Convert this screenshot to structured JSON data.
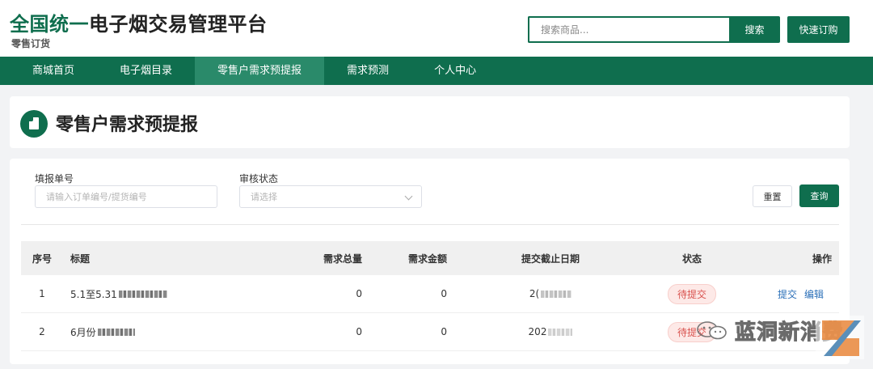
{
  "header": {
    "title_accent": "全国统一",
    "title_rest": "电子烟交易管理平台",
    "subtitle": "零售订货",
    "search_placeholder": "搜索商品...",
    "search_button": "搜索",
    "quick_order_button": "快速订购"
  },
  "nav": {
    "items": [
      {
        "label": "商城首页",
        "active": false
      },
      {
        "label": "电子烟目录",
        "active": false
      },
      {
        "label": "零售户需求预提报",
        "active": true
      },
      {
        "label": "需求预测",
        "active": false
      },
      {
        "label": "个人中心",
        "active": false
      }
    ]
  },
  "page": {
    "title": "零售户需求预提报"
  },
  "filters": {
    "order_no_label": "填报单号",
    "order_no_placeholder": "请输入订单编号/提货编号",
    "status_label": "审核状态",
    "status_placeholder": "请选择",
    "reset_button": "重置",
    "query_button": "查询"
  },
  "table": {
    "headers": [
      "序号",
      "标题",
      "需求总量",
      "需求金额",
      "提交截止日期",
      "状态",
      "操作"
    ],
    "rows": [
      {
        "index": "1",
        "title": "5.1至5.31",
        "quantity": "0",
        "amount": "0",
        "deadline": "2(",
        "status": "待提交",
        "ops": [
          "提交",
          "编辑"
        ]
      },
      {
        "index": "2",
        "title": "6月份",
        "quantity": "0",
        "amount": "0",
        "deadline": "202",
        "status": "待提交",
        "ops": []
      }
    ]
  },
  "watermark": {
    "text": "蓝洞新消费"
  },
  "colors": {
    "brand_green": "#0f6e4e",
    "nav_active": "#2a8a6a",
    "status_red": "#d9534f",
    "link_blue": "#2a6fb8"
  }
}
